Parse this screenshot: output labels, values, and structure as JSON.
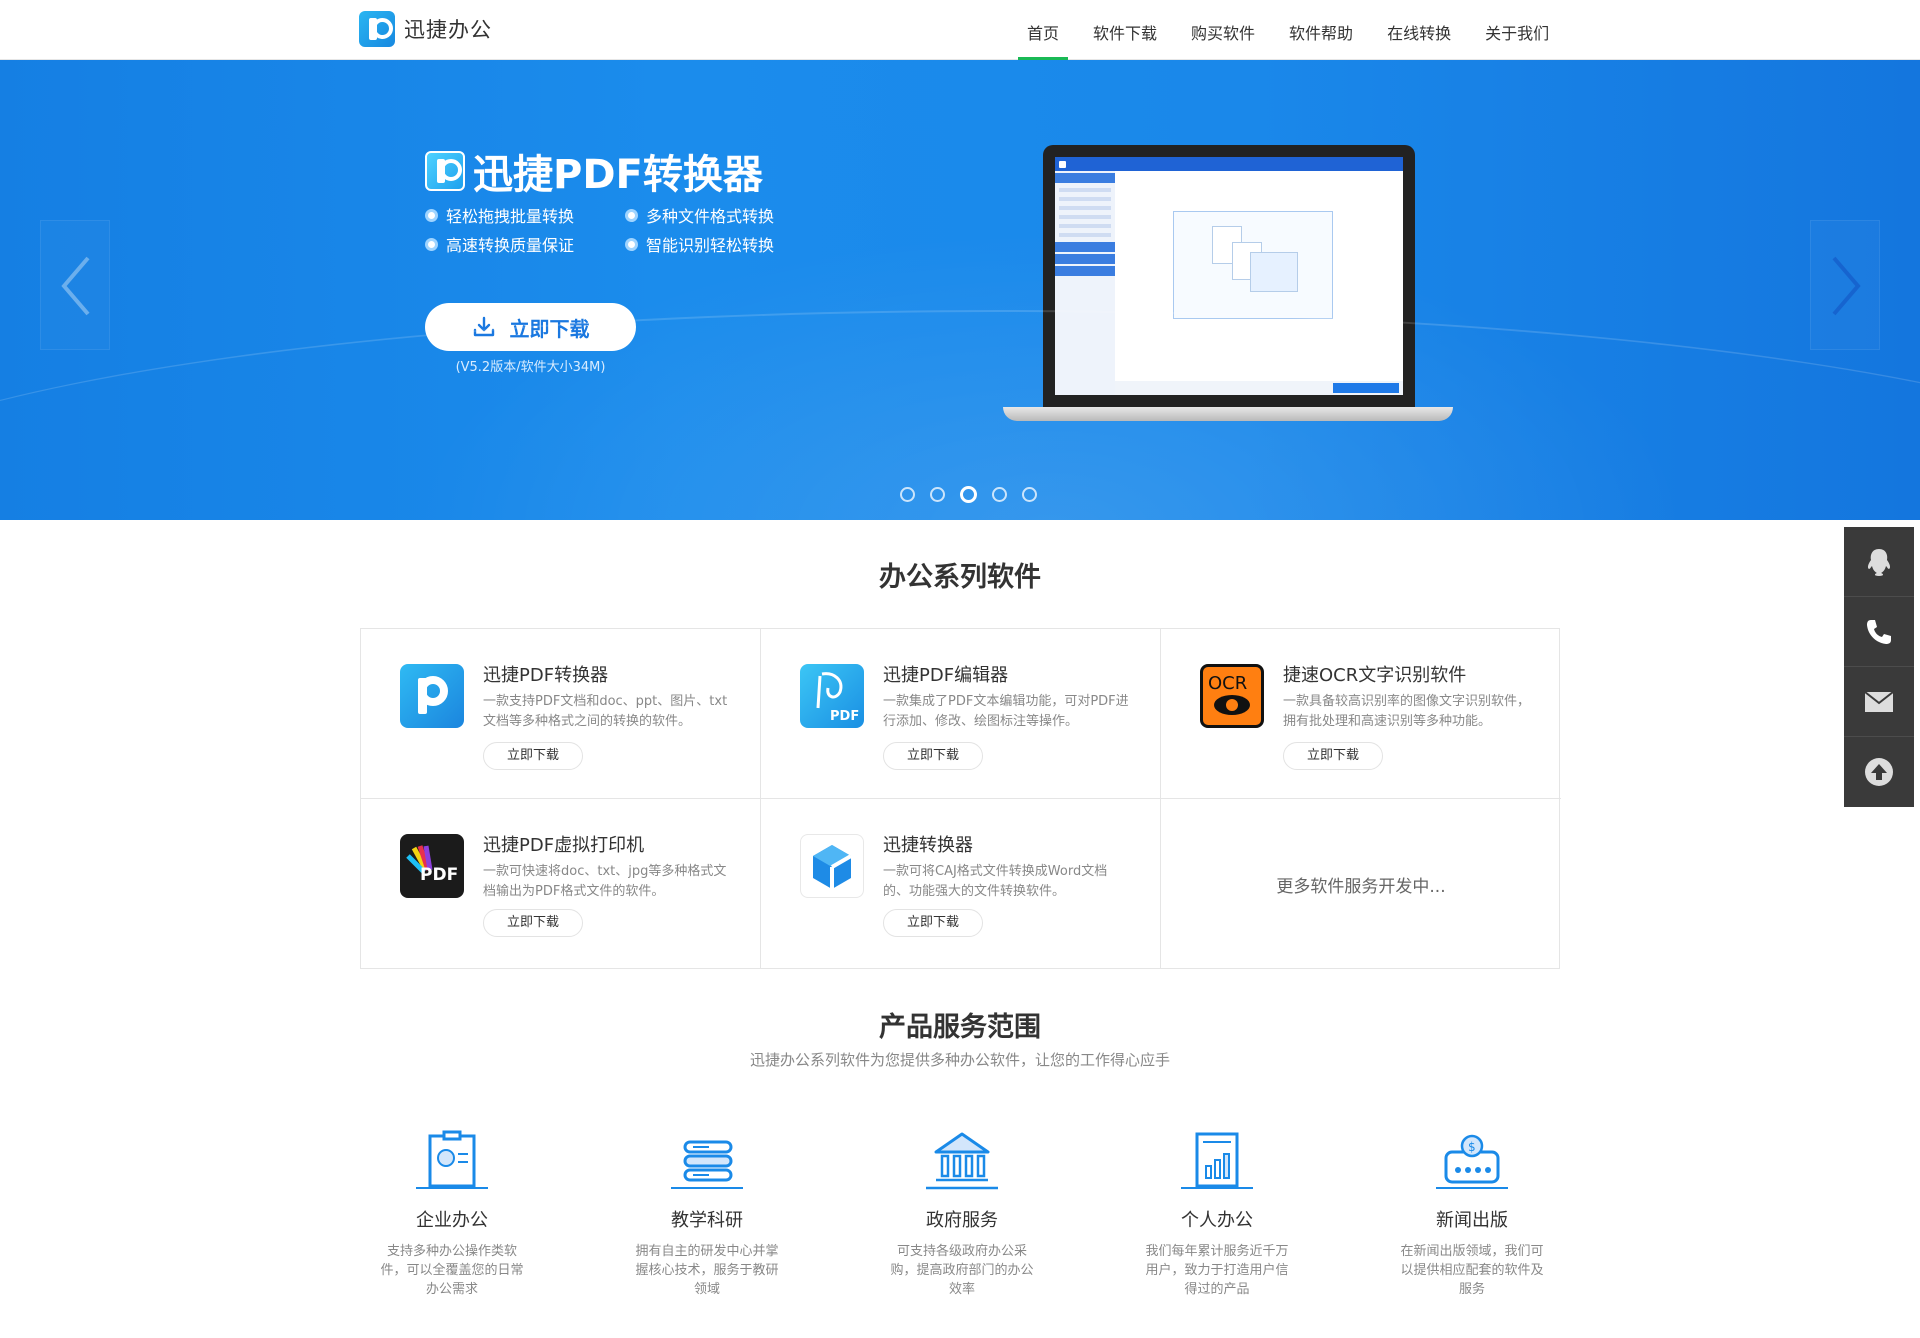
{
  "header": {
    "logo_text": "迅捷办公",
    "nav": [
      {
        "label": "首页",
        "active": true
      },
      {
        "label": "软件下载"
      },
      {
        "label": "购买软件"
      },
      {
        "label": "软件帮助"
      },
      {
        "label": "在线转换"
      },
      {
        "label": "关于我们"
      }
    ]
  },
  "banner": {
    "title": "迅捷PDF转换器",
    "features": [
      "轻松拖拽批量转换",
      "多种文件格式转换",
      "高速转换质量保证",
      "智能识别轻松转换"
    ],
    "download_label": "立即下载",
    "version_text": "(V5.2版本/软件大小34M)",
    "slide_count": 5,
    "active_slide": 3
  },
  "software_section": {
    "title": "办公系列软件",
    "items": [
      {
        "name": "迅捷PDF转换器",
        "desc": "一款支持PDF文档和doc、ppt、图片、txt文档等多种格式之间的转换的软件。",
        "button": "立即下载",
        "icon": "pdf-converter-icon"
      },
      {
        "name": "迅捷PDF编辑器",
        "desc": "一款集成了PDF文本编辑功能，可对PDF进行添加、修改、绘图标注等操作。",
        "button": "立即下载",
        "icon": "pdf-editor-icon"
      },
      {
        "name": "捷速OCR文字识别软件",
        "desc": "一款具备较高识别率的图像文字识别软件，拥有批处理和高速识别等多种功能。",
        "button": "立即下载",
        "icon": "ocr-icon"
      },
      {
        "name": "迅捷PDF虚拟打印机",
        "desc": "一款可快速将doc、txt、jpg等多种格式文档输出为PDF格式文件的软件。",
        "button": "立即下载",
        "icon": "pdf-printer-icon"
      },
      {
        "name": "迅捷转换器",
        "desc": "一款可将CAJ格式文件转换成Word文档的、功能强大的文件转换软件。",
        "button": "立即下载",
        "icon": "caj-converter-icon"
      }
    ],
    "more_text": "更多软件服务开发中..."
  },
  "service_section": {
    "title": "产品服务范围",
    "subtitle": "迅捷办公系列软件为您提供多种办公软件，让您的工作得心应手",
    "items": [
      {
        "name": "企业办公",
        "desc": "支持多种办公操作类软件，可以全覆盖您的日常办公需求",
        "icon": "enterprise-icon"
      },
      {
        "name": "教学科研",
        "desc": "拥有自主的研发中心并掌握核心技术，服务于教研领域",
        "icon": "research-icon"
      },
      {
        "name": "政府服务",
        "desc": "可支持各级政府办公采购，提高政府部门的办公效率",
        "icon": "government-icon"
      },
      {
        "name": "个人办公",
        "desc": "我们每年累计服务近千万用户，致力于打造用户信得过的产品",
        "icon": "personal-icon"
      },
      {
        "name": "新闻出版",
        "desc": "在新闻出版领域，我们可以提供相应配套的软件及服务",
        "icon": "publishing-icon"
      }
    ]
  },
  "colors": {
    "brand_blue": "#1a88ea",
    "nav_active": "#19b955",
    "float_bar": "#3a3a3a"
  }
}
